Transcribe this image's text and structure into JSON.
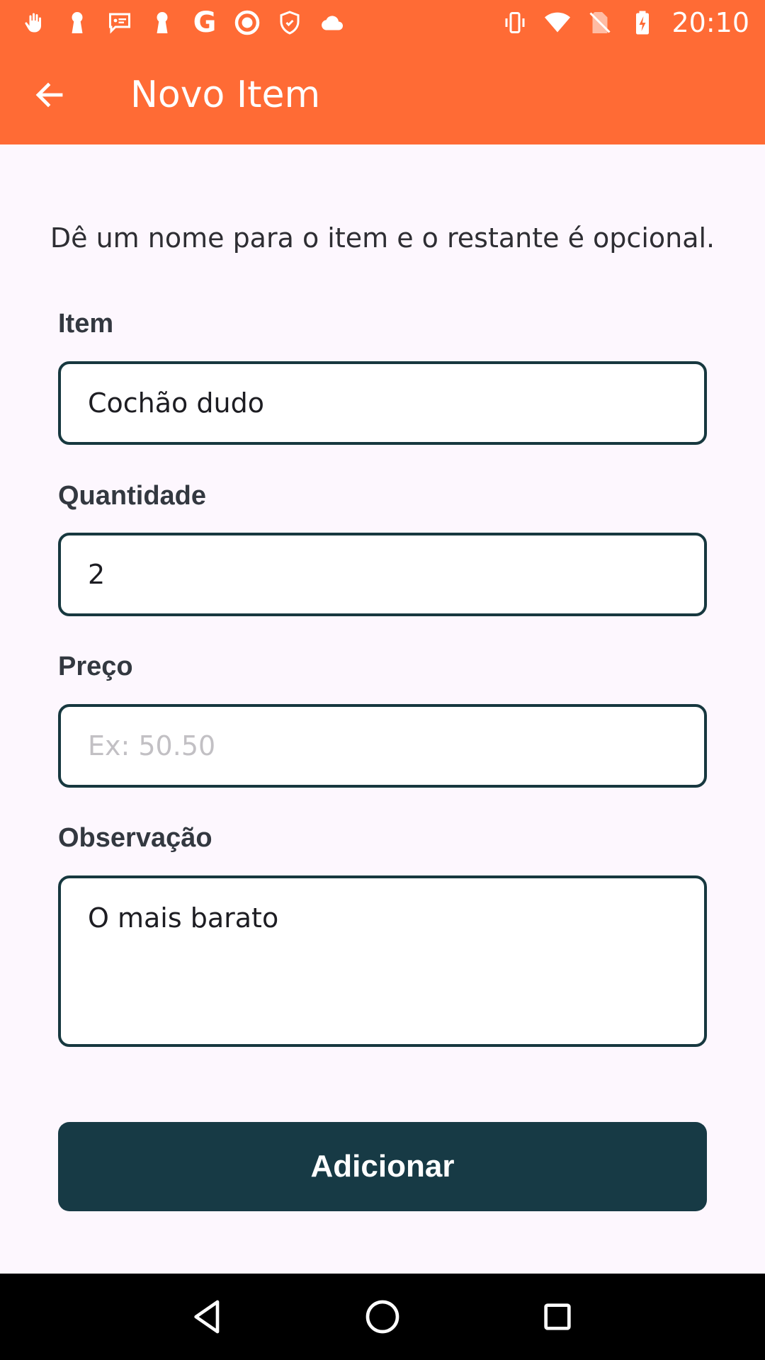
{
  "status_bar": {
    "time": "20:10",
    "left_icons": [
      "hand-icon",
      "keyhole-icon",
      "chat-icon",
      "keyhole-icon",
      "google-icon",
      "record-icon",
      "shield-icon",
      "cloud-icon"
    ],
    "right_icons": [
      "vibrate-icon",
      "wifi-icon",
      "no-sim-icon",
      "battery-charging-icon"
    ]
  },
  "app_bar": {
    "title": "Novo Item",
    "back_icon": "arrow-back-icon",
    "background": "#FF6B35"
  },
  "form": {
    "intro": "Dê um nome para o item e o restante é opcional.",
    "item": {
      "label": "Item",
      "value": "Cochão dudo"
    },
    "quantity": {
      "label": "Quantidade",
      "value": "2"
    },
    "price": {
      "label": "Preço",
      "value": "",
      "placeholder": "Ex: 50.50"
    },
    "note": {
      "label": "Observação",
      "value": "O mais barato"
    },
    "submit_label": "Adicionar",
    "accent": "#173A45"
  },
  "nav_bar": {
    "icons": [
      "back-triangle-icon",
      "home-circle-icon",
      "recents-square-icon"
    ]
  }
}
